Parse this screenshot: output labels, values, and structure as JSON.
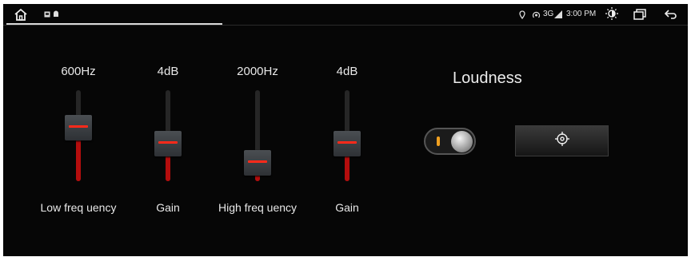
{
  "status_bar": {
    "signal_text": "3G",
    "time": "3:00 PM",
    "icons": [
      "home-icon",
      "gallery-icon",
      "android-icon",
      "location-icon",
      "hotspot-icon",
      "signal-icon",
      "brightness-icon",
      "recent-apps-icon",
      "back-icon"
    ]
  },
  "equalizer": {
    "sliders": [
      {
        "value_label": "600Hz",
        "label": "Low freq uency",
        "level": 0.62
      },
      {
        "value_label": "4dB",
        "label": "Gain",
        "level": 0.38
      },
      {
        "value_label": "2000Hz",
        "label": "High freq uency",
        "level": 0.1
      },
      {
        "value_label": "4dB",
        "label": "Gain",
        "level": 0.38
      }
    ]
  },
  "loudness": {
    "title": "Loudness",
    "toggle_on": true,
    "reset_icon": "target-icon"
  },
  "colors": {
    "background": "#060606",
    "fill": "#b40d0d",
    "thumb_line": "#ff2a1a",
    "toggle_indicator": "#f0a020"
  }
}
